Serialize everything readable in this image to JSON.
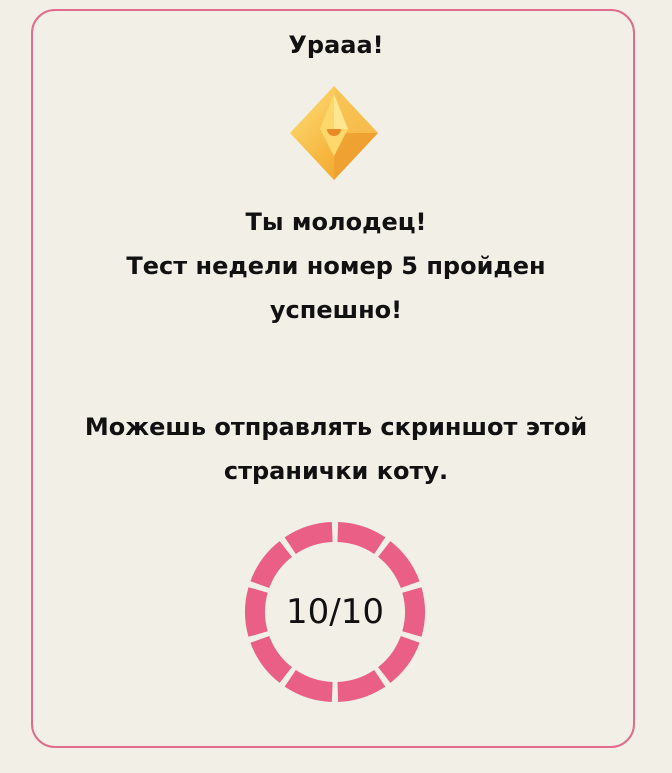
{
  "result_card": {
    "title": "Урааа!",
    "crystal_icon": "plumbob-crystal-icon",
    "congrats_lines": [
      "Ты молодец!",
      "Тест недели номер 5 пройден",
      "успешно!"
    ],
    "instruction_lines": [
      "Можешь отправлять скриншот этой",
      "странички коту."
    ],
    "score": {
      "label": "10/10",
      "correct": 10,
      "total": 10
    }
  },
  "colors": {
    "background": "#f2efe7",
    "accent": "#ea5f85",
    "card_border": "#e06b8c",
    "crystal": "#f6b43d",
    "text": "#111111"
  }
}
